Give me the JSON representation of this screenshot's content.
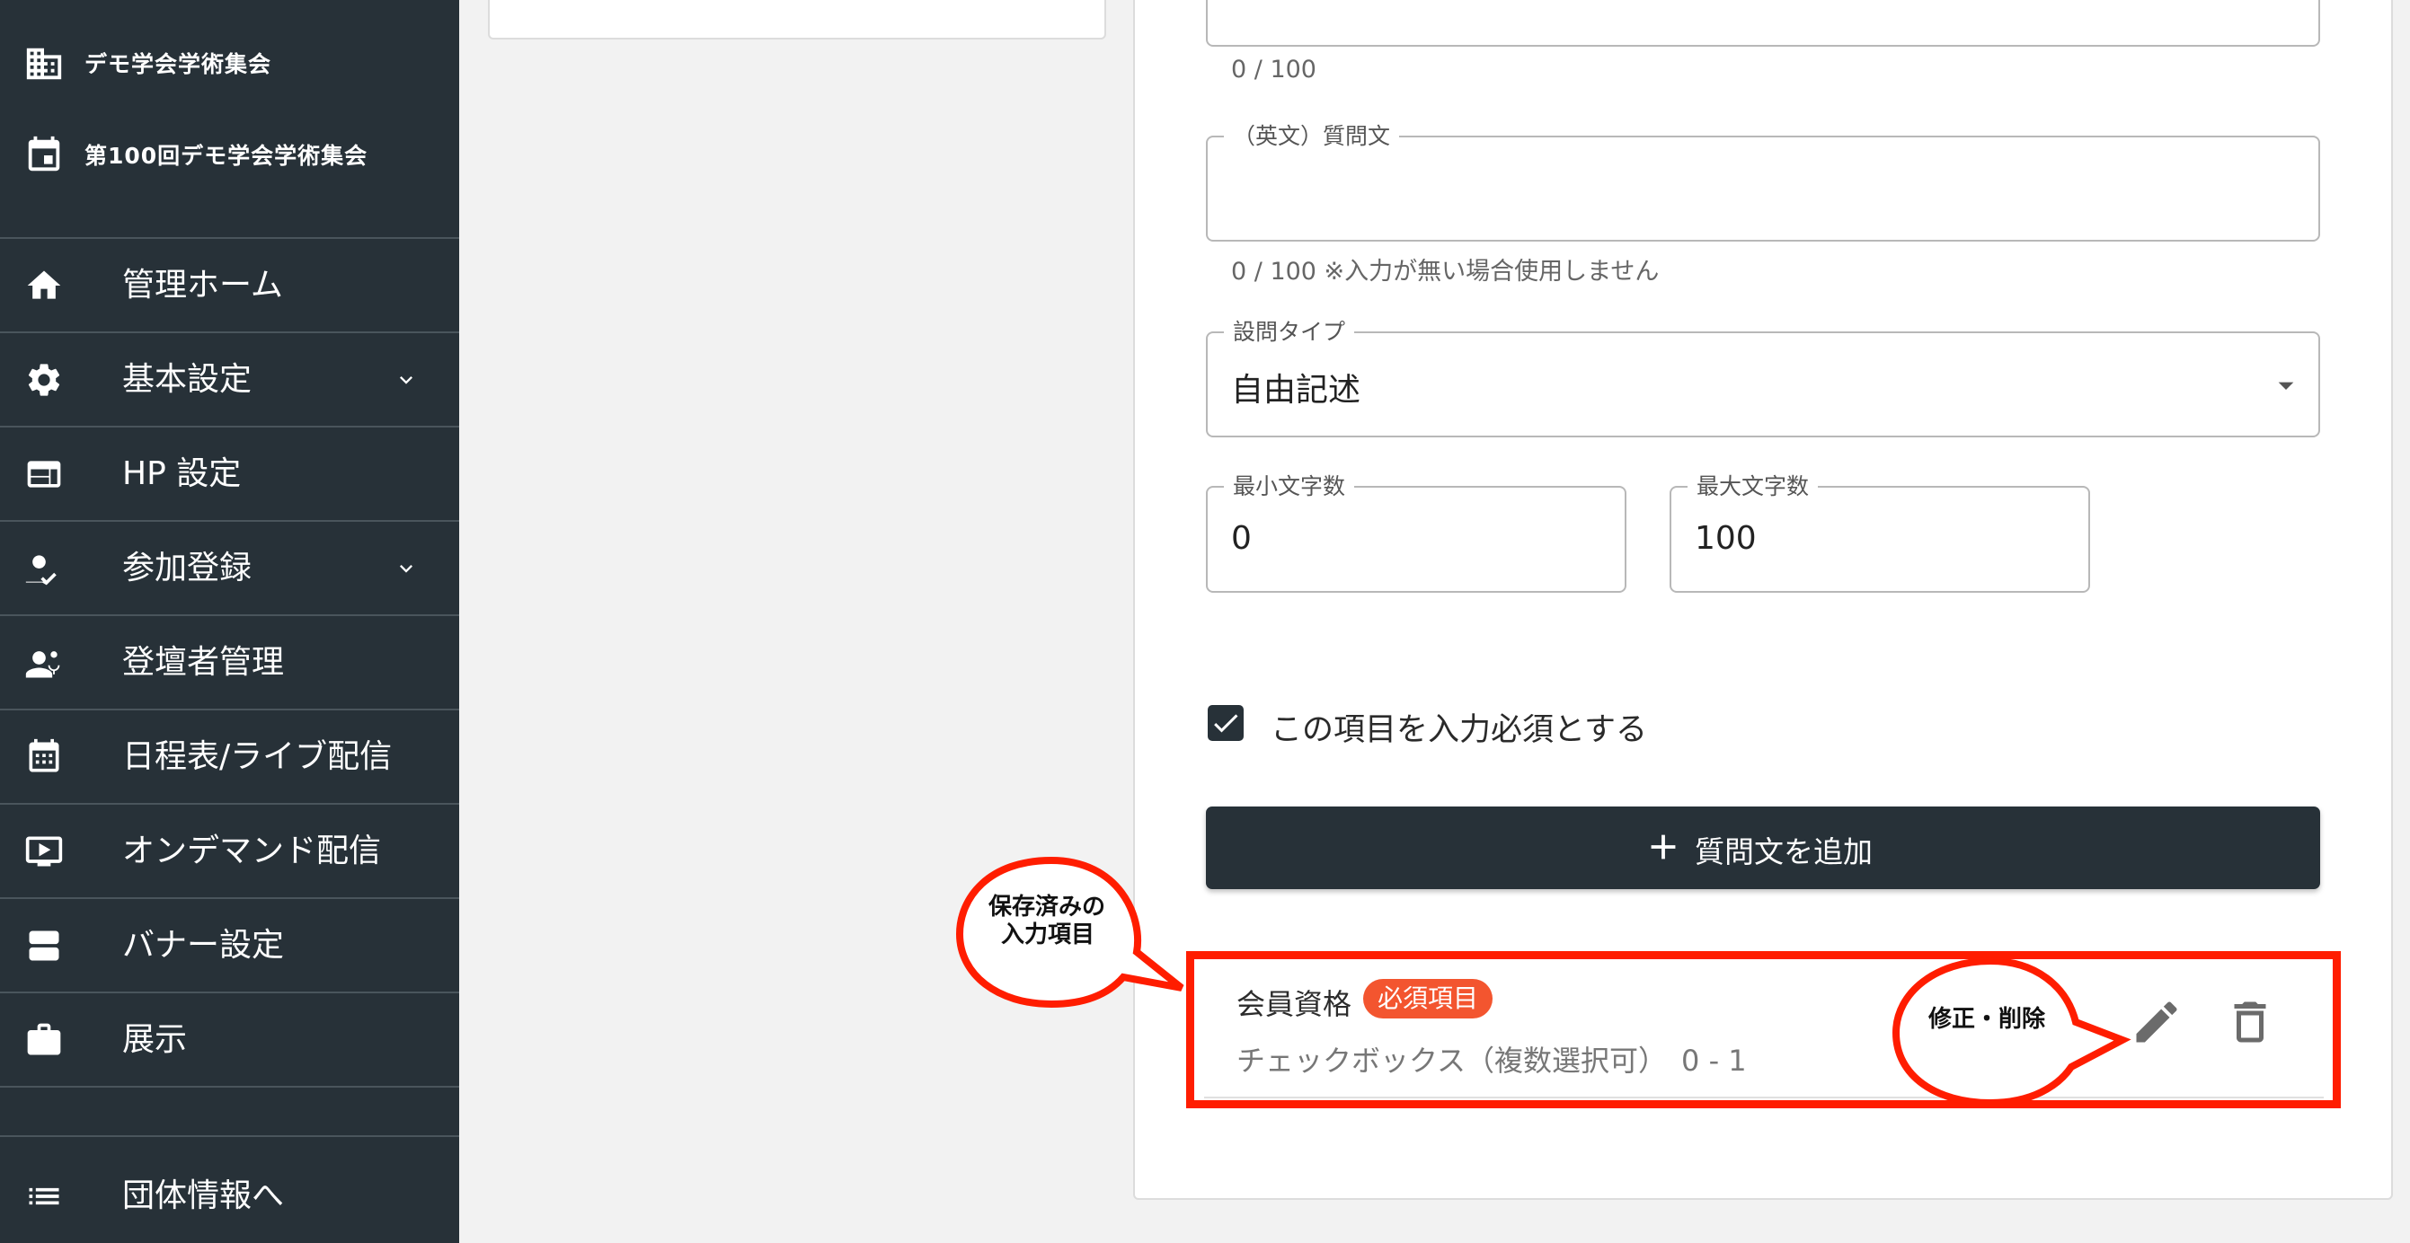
{
  "sidebar": {
    "org_name": "デモ学会学術集会",
    "event_name": "第100回デモ学会学術集会",
    "items": [
      {
        "label": "管理ホーム",
        "icon": "home-icon",
        "has_submenu": false
      },
      {
        "label": "基本設定",
        "icon": "gear-icon",
        "has_submenu": true
      },
      {
        "label": "HP 設定",
        "icon": "web-icon",
        "has_submenu": false
      },
      {
        "label": "参加登録",
        "icon": "user-check-icon",
        "has_submenu": true
      },
      {
        "label": "登壇者管理",
        "icon": "speaker-icon",
        "has_submenu": false
      },
      {
        "label": "日程表/ライブ配信",
        "icon": "calendar-icon",
        "has_submenu": false
      },
      {
        "label": "オンデマンド配信",
        "icon": "video-icon",
        "has_submenu": false
      },
      {
        "label": "バナー設定",
        "icon": "banner-icon",
        "has_submenu": false
      },
      {
        "label": "展示",
        "icon": "briefcase-icon",
        "has_submenu": false
      }
    ],
    "footer_item": {
      "label": "団体情報へ",
      "icon": "list-icon"
    }
  },
  "form": {
    "question_ja_counter": "0 / 100",
    "question_en": {
      "label": "（英文）質問文",
      "value": "",
      "helper": "0 / 100 ※入力が無い場合使用しません"
    },
    "question_type": {
      "label": "設問タイプ",
      "value": "自由記述"
    },
    "min_chars": {
      "label": "最小文字数",
      "value": "0"
    },
    "max_chars": {
      "label": "最大文字数",
      "value": "100"
    },
    "required_checkbox": {
      "label": "この項目を入力必須とする",
      "checked": true
    },
    "add_button_label": "質問文を追加"
  },
  "saved_item": {
    "title": "会員資格",
    "badge": "必須項目",
    "subtitle": "チェックボックス（複数選択可）　0 - 1"
  },
  "annotations": {
    "saved_callout_line1": "保存済みの",
    "saved_callout_line2": "入力項目",
    "edit_callout": "修正・削除"
  },
  "colors": {
    "sidebar_bg": "#273138",
    "primary": "#273138",
    "badge": "#f3552f",
    "annotation_red": "#ff1d00"
  }
}
